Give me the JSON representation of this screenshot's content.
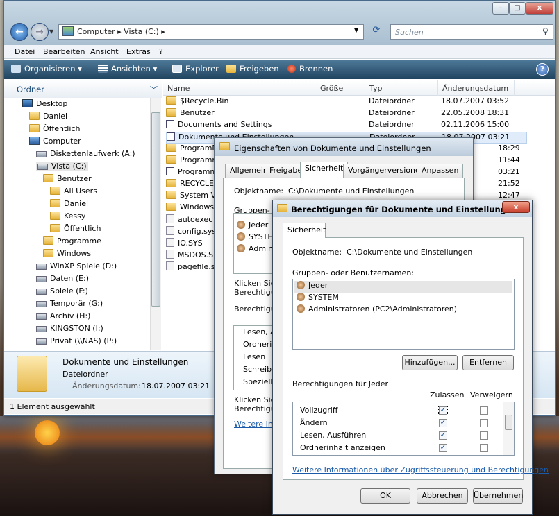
{
  "explorer": {
    "window_buttons": {
      "min": "–",
      "max": "□",
      "close": "x"
    },
    "address_crumbs": "Computer  ▸  Vista (C:)  ▸",
    "search_placeholder": "Suchen",
    "menu": [
      "Datei",
      "Bearbeiten",
      "Ansicht",
      "Extras",
      "?"
    ],
    "toolbar": [
      "Organisieren ▾",
      "Ansichten ▾",
      "Explorer",
      "Freigeben",
      "Brennen"
    ],
    "nav_title": "Ordner",
    "tree": [
      {
        "label": "Desktop",
        "icon": "desktop-icon"
      },
      {
        "label": "Daniel",
        "icon": "folder-icon"
      },
      {
        "label": "Öffentlich",
        "icon": "folder-icon"
      },
      {
        "label": "Computer",
        "icon": "computer-icon"
      },
      {
        "label": "Diskettenlaufwerk (A:)",
        "icon": "drive-icon"
      },
      {
        "label": "Vista (C:)",
        "icon": "drive-icon"
      },
      {
        "label": "Benutzer",
        "icon": "folder-icon"
      },
      {
        "label": "All Users",
        "icon": "shortcut-folder-icon"
      },
      {
        "label": "Daniel",
        "icon": "folder-icon"
      },
      {
        "label": "Kessy",
        "icon": "folder-icon"
      },
      {
        "label": "Öffentlich",
        "icon": "folder-icon"
      },
      {
        "label": "Programme",
        "icon": "folder-icon"
      },
      {
        "label": "Windows",
        "icon": "folder-icon"
      },
      {
        "label": "WinXP Spiele (D:)",
        "icon": "drive-icon"
      },
      {
        "label": "Daten (E:)",
        "icon": "drive-icon"
      },
      {
        "label": "Spiele (F:)",
        "icon": "drive-icon"
      },
      {
        "label": "Temporär (G:)",
        "icon": "drive-icon"
      },
      {
        "label": "Archiv (H:)",
        "icon": "drive-icon"
      },
      {
        "label": "KINGSTON (I:)",
        "icon": "drive-icon"
      },
      {
        "label": "Privat (\\\\NAS) (P:)",
        "icon": "drive-icon"
      }
    ],
    "columns": [
      "Name",
      "Größe",
      "Typ",
      "Änderungsdatum"
    ],
    "files": [
      {
        "name": "$Recycle.Bin",
        "type": "Dateiordner",
        "date": "18.07.2007 03:52"
      },
      {
        "name": "Benutzer",
        "type": "Dateiordner",
        "date": "22.05.2008 18:31"
      },
      {
        "name": "Documents and Settings",
        "type": "Dateiordner",
        "date": "02.11.2006 15:00"
      },
      {
        "name": "Dokumente und Einstellungen",
        "type": "Dateiordner",
        "date": "18.07.2007 03:21"
      },
      {
        "name": "ProgramD",
        "type": "",
        "date": "18:29"
      },
      {
        "name": "Programm",
        "type": "",
        "date": "11:44"
      },
      {
        "name": "Programm",
        "type": "",
        "date": "03:21"
      },
      {
        "name": "RECYCLEI",
        "type": "",
        "date": "21:52"
      },
      {
        "name": "System Vo",
        "type": "",
        "date": "12:47"
      },
      {
        "name": "Windows",
        "type": "",
        "date": ""
      },
      {
        "name": "autoexec",
        "type": "",
        "date": ""
      },
      {
        "name": "config.sys",
        "type": "",
        "date": ""
      },
      {
        "name": "IO.SYS",
        "type": "",
        "date": ""
      },
      {
        "name": "MSDOS.S",
        "type": "",
        "date": ""
      },
      {
        "name": "pagefile.s",
        "type": "",
        "date": ""
      }
    ],
    "details": {
      "name": "Dokumente und Einstellungen",
      "type": "Dateiordner",
      "date_label": "Änderungsdatum:",
      "date_value": "18.07.2007 03:21"
    },
    "status": "1 Element ausgewählt"
  },
  "props": {
    "title": "Eigenschaften von Dokumente und Einstellungen",
    "tabs": [
      "Allgemein",
      "Freigabe",
      "Sicherheit",
      "Vorgängerversionen",
      "Anpassen"
    ],
    "object_label": "Objektname:",
    "object_value": "C:\\Dokumente und Einstellungen",
    "groups_label": "Gruppen- od",
    "users": [
      "Jeder",
      "SYSTEM",
      "Admini"
    ],
    "click1a": "Klicken Sie",
    "click1b": "Berechtigu",
    "perm_label": "Berechtigu",
    "perms": [
      "Lesen, A",
      "Ordnerinl",
      "Lesen",
      "Schreibe",
      "Speziell"
    ],
    "click2a": "Klicken Sie",
    "click2b": "Berechtigu",
    "link": "Weitere Info"
  },
  "perm": {
    "title": "Berechtigungen für Dokumente und Einstellungen",
    "close": "x",
    "tab": "Sicherheit",
    "object_label": "Objektname:",
    "object_value": "C:\\Dokumente und Einstellungen",
    "groups_label": "Gruppen- oder Benutzernamen:",
    "users": [
      "Jeder",
      "SYSTEM",
      "Administratoren (PC2\\Administratoren)"
    ],
    "add_button": "Hinzufügen...",
    "remove_button": "Entfernen",
    "perms_label": "Berechtigungen für Jeder",
    "allow_label": "Zulassen",
    "deny_label": "Verweigern",
    "rows": [
      {
        "label": "Vollzugriff",
        "allow": true,
        "deny": false
      },
      {
        "label": "Ändern",
        "allow": true,
        "deny": false
      },
      {
        "label": "Lesen, Ausführen",
        "allow": true,
        "deny": false
      },
      {
        "label": "Ordnerinhalt anzeigen",
        "allow": true,
        "deny": false
      }
    ],
    "link": "Weitere Informationen über Zugriffssteuerung und Berechtigungen",
    "ok": "OK",
    "cancel": "Abbrechen",
    "apply": "Übernehmen"
  }
}
